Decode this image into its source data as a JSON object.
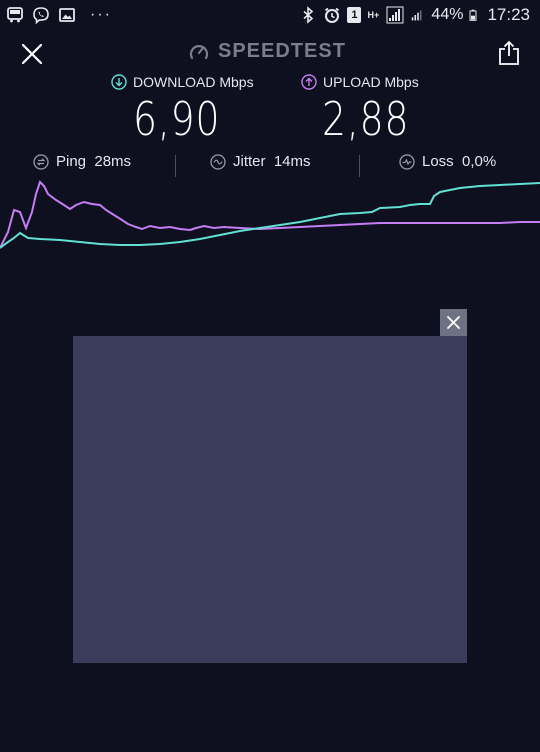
{
  "status_bar": {
    "battery_percent": "44%",
    "time": "17:23",
    "network": "H+",
    "notification_count": "1",
    "more_indicator": "···",
    "left_icons": [
      "bus-icon",
      "viber-icon",
      "gallery-icon"
    ],
    "right_icons": [
      "bluetooth-icon",
      "alarm-icon",
      "notification-badge-icon",
      "network-type-icon",
      "signal-icon",
      "signal-2-icon",
      "battery-icon"
    ]
  },
  "header": {
    "title": "SPEEDTEST",
    "close_icon": "close-icon",
    "share_icon": "share-icon",
    "logo_icon": "speedometer-icon"
  },
  "download": {
    "label": "DOWNLOAD Mbps",
    "value": "6,90",
    "color": "#62e0d4",
    "icon": "arrow-down-icon"
  },
  "upload": {
    "label": "UPLOAD Mbps",
    "value": "2,88",
    "color": "#c47ef2",
    "icon": "arrow-up-icon"
  },
  "stats": {
    "ping": "Ping  28ms",
    "jitter": "Jitter  14ms",
    "loss": "Loss  0,0%"
  },
  "ad": {
    "close_icon": "close-icon",
    "background": "#3b3c5c"
  },
  "colors": {
    "background": "#0e0f1f",
    "muted": "#7b7d8e"
  }
}
